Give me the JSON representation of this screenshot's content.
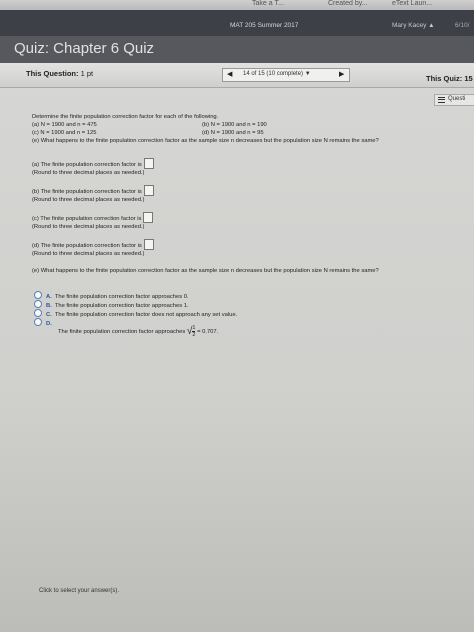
{
  "browser": {
    "tabs": [
      "Take a T...",
      "Created by...",
      "eText Laun..."
    ]
  },
  "header": {
    "course": "MAT 205 Summer 2017",
    "user": "Mary Kacey",
    "date": "6/10/"
  },
  "quiz": {
    "title": "Quiz: Chapter 6 Quiz",
    "this_question_label": "This Question:",
    "this_question_value": "1 pt",
    "nav_progress": "14 of 15 (10 complete)",
    "this_quiz_label": "This Quiz:",
    "this_quiz_value": "15",
    "question_list_label": "Questi"
  },
  "question": {
    "prompt": "Determine the finite population correction factor for each of the following.",
    "part_a": "(a) N = 1900 and n = 475",
    "part_b": "(b) N = 1900 and n = 190",
    "part_c": "(c) N = 1900 and n = 125",
    "part_d": "(d) N = 1900 and n = 95",
    "part_e": "(e) What happens to the finite population correction factor as the sample size n decreases but the population size N remains the same?",
    "answers": [
      {
        "label": "(a) The finite population correction factor is",
        "hint": "(Round to three decimal places as needed.)"
      },
      {
        "label": "(b) The finite population correction factor is",
        "hint": "(Round to three decimal places as needed.)"
      },
      {
        "label": "(c) The finite population correction factor is",
        "hint": "(Round to three decimal places as needed.)"
      },
      {
        "label": "(d) The finite population correction factor is",
        "hint": "(Round to three decimal places as needed.)"
      }
    ],
    "part_e_repeat": "(e) What happens to the finite population correction factor as the sample size n decreases but the population size N remains the same?",
    "options": [
      {
        "letter": "A.",
        "text": "The finite population correction factor approaches 0."
      },
      {
        "letter": "B.",
        "text": "The finite population correction factor approaches 1."
      },
      {
        "letter": "C.",
        "text": "The finite population correction factor does not approach any set value."
      },
      {
        "letter": "D.",
        "text": "The finite population correction factor approaches",
        "frac_num": "1",
        "frac_den": "2",
        "tail": "= 0.707."
      }
    ]
  },
  "footer": {
    "instruction": "Click to select your answer(s)."
  }
}
